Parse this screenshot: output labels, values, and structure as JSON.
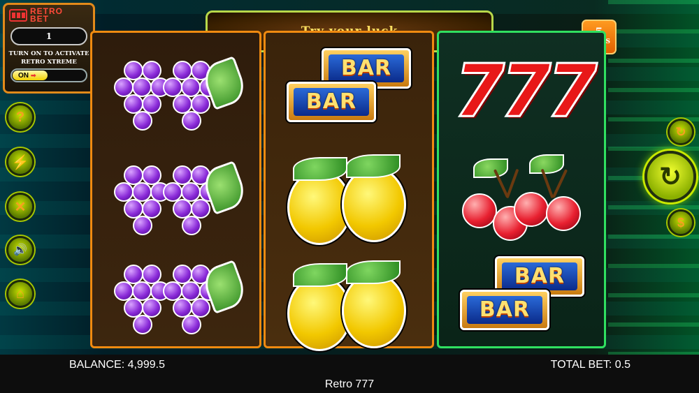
{
  "logo": {
    "line1": "RETRO",
    "line2": "BET"
  },
  "xtreme": {
    "multiplier": "1",
    "activate_text_1": "TURN ON TO ACTIVATE",
    "activate_text_2": "RETRO XTREME",
    "toggle_label": "ON"
  },
  "banner": {
    "text": "Try your luck"
  },
  "lines": {
    "count": "5",
    "label": "LINES"
  },
  "side_buttons": {
    "help": "?",
    "turbo": "⚡",
    "settings": "✕",
    "sound": "🔊",
    "home": "⌂"
  },
  "right_buttons": {
    "autoplay": "↻",
    "spin": "↻",
    "bet": "$"
  },
  "reels": [
    [
      "grapes",
      "grapes",
      "grapes"
    ],
    [
      "bar-double",
      "lemon",
      "lemon"
    ],
    [
      "777",
      "cherries",
      "bar-double"
    ]
  ],
  "symbols": {
    "bar_text": "BAR",
    "sevens_text": "777"
  },
  "footer": {
    "balance": "BALANCE: 4,999.5",
    "total_bet": "TOTAL BET: 0.5",
    "game_title": "Retro 777"
  },
  "colors": {
    "reel_border_orange": "#f08a10",
    "reel_border_green": "#30e060",
    "accent_green": "#c8e800"
  }
}
